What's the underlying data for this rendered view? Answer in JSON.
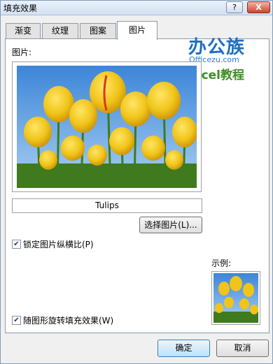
{
  "window": {
    "title": "填充效果",
    "help": "?",
    "close": "X"
  },
  "tabs": [
    "渐变",
    "纹理",
    "图案",
    "图片"
  ],
  "active_tab": "图片",
  "picture_label": "图片:",
  "picture_name": "Tulips",
  "choose_button": "选择图片(L)...",
  "lock_aspect": {
    "label": "锁定图片纵横比(P)",
    "checked": true
  },
  "sample_label": "示例:",
  "rotate_with_shape": {
    "label": "随图形旋转填充效果(W)",
    "checked": true
  },
  "buttons": {
    "ok": "确定",
    "cancel": "取消"
  },
  "watermark": {
    "main": "办公族",
    "sub": "Officezu.com",
    "excel": "Excel教程"
  },
  "colors": {
    "sky": "#6aa9e6",
    "petal": "#f0c419",
    "stem": "#3f7a1e",
    "ok_border": "#3c7fb1"
  }
}
